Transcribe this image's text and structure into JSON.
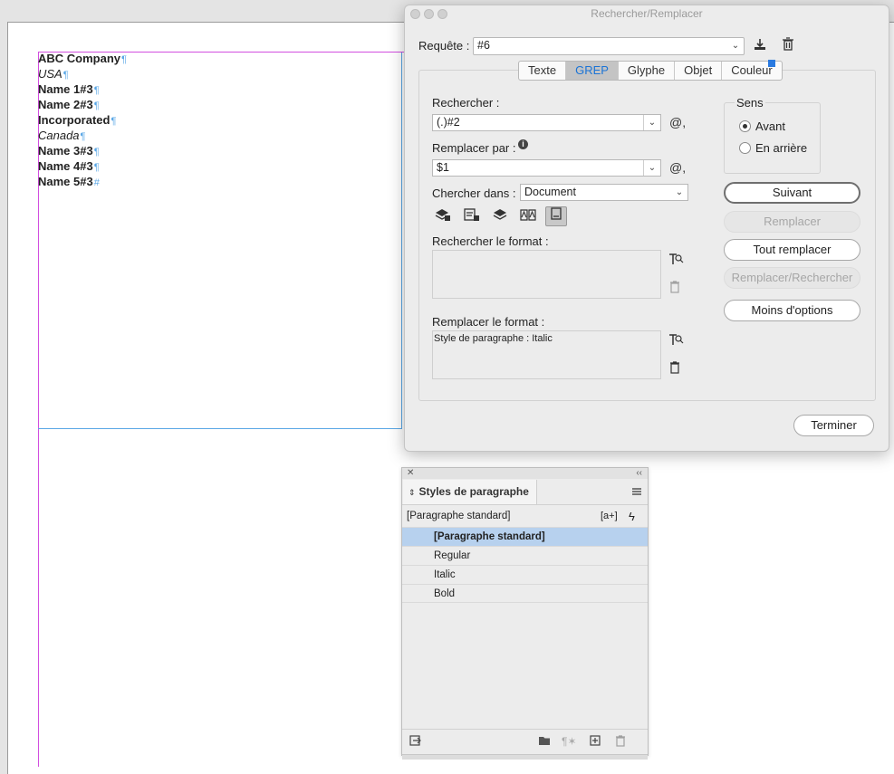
{
  "document": {
    "lines": [
      {
        "text": "ABC Company",
        "style": "bold"
      },
      {
        "text": "USA",
        "style": "italic"
      },
      {
        "text": "Name 1#3",
        "style": "bold"
      },
      {
        "text": "Name 2#3",
        "style": "bold"
      },
      {
        "text": "Incorporated",
        "style": "bold"
      },
      {
        "text": "Canada",
        "style": "italic"
      },
      {
        "text": "Name 3#3",
        "style": "bold"
      },
      {
        "text": "Name 4#3",
        "style": "bold"
      },
      {
        "text": "Name 5#3",
        "style": "bold"
      }
    ],
    "pilcrow": "¶",
    "end_mark": "#"
  },
  "dialog": {
    "title": "Rechercher/Remplacer",
    "query_label": "Requête :",
    "query_value": "#6",
    "tabs": [
      "Texte",
      "GREP",
      "Glyphe",
      "Objet",
      "Couleur"
    ],
    "active_tab": "GREP",
    "find_label": "Rechercher :",
    "find_value": "(.)#2",
    "replace_label": "Remplacer par :",
    "replace_value": "$1",
    "search_in_label": "Chercher dans :",
    "search_in_value": "Document",
    "find_format_label": "Rechercher le format :",
    "find_format_value": "",
    "replace_format_label": "Remplacer le format :",
    "replace_format_value": "Style de paragraphe : Italic",
    "direction": {
      "label": "Sens",
      "forward": "Avant",
      "backward": "En arrière",
      "selected": "Avant"
    },
    "buttons": {
      "next": "Suivant",
      "replace": "Remplacer",
      "replace_all": "Tout remplacer",
      "replace_find": "Remplacer/Rechercher",
      "fewer_options": "Moins d'options",
      "done": "Terminer"
    }
  },
  "panel": {
    "title": "Styles de paragraphe",
    "current_style": "[Paragraphe standard]",
    "new_style_glyph": "[a+]",
    "styles": [
      "[Paragraphe standard]",
      "Regular",
      "Italic",
      "Bold"
    ],
    "selected_style": "[Paragraphe standard]"
  }
}
